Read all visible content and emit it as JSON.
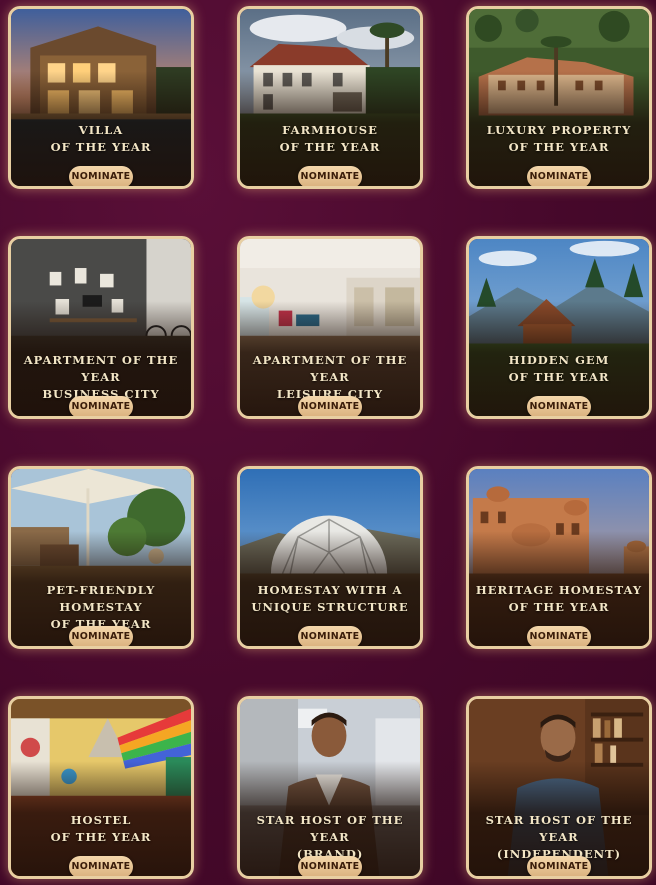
{
  "nominate_label": "NOMINATE",
  "cards": [
    {
      "title": "VILLA\nOF THE YEAR",
      "scene": "villa-photo"
    },
    {
      "title": "FARMHOUSE\nOF THE YEAR",
      "scene": "farmhouse-photo"
    },
    {
      "title": "LUXURY PROPERTY\nOF THE YEAR",
      "scene": "luxury-property-photo"
    },
    {
      "title": "APARTMENT OF THE YEAR\nBUSINESS CITY",
      "scene": "business-apartment-photo"
    },
    {
      "title": "APARTMENT OF THE YEAR\nLEISURE CITY",
      "scene": "leisure-apartment-photo"
    },
    {
      "title": "HIDDEN GEM\nOF THE YEAR",
      "scene": "hidden-gem-photo"
    },
    {
      "title": "PET-FRIENDLY HOMESTAY\nOF THE YEAR",
      "scene": "pet-friendly-photo"
    },
    {
      "title": "HOMESTAY WITH A\nUNIQUE STRUCTURE",
      "scene": "geodesic-dome-photo"
    },
    {
      "title": "HERITAGE HOMESTAY\nOF THE YEAR",
      "scene": "heritage-palace-photo"
    },
    {
      "title": "HOSTEL\nOF THE YEAR",
      "scene": "hostel-photo"
    },
    {
      "title": "STAR HOST OF THE YEAR\n(BRAND)",
      "scene": "brand-host-photo"
    },
    {
      "title": "STAR HOST OF THE YEAR\n(INDEPENDENT)",
      "scene": "independent-host-photo"
    }
  ]
}
